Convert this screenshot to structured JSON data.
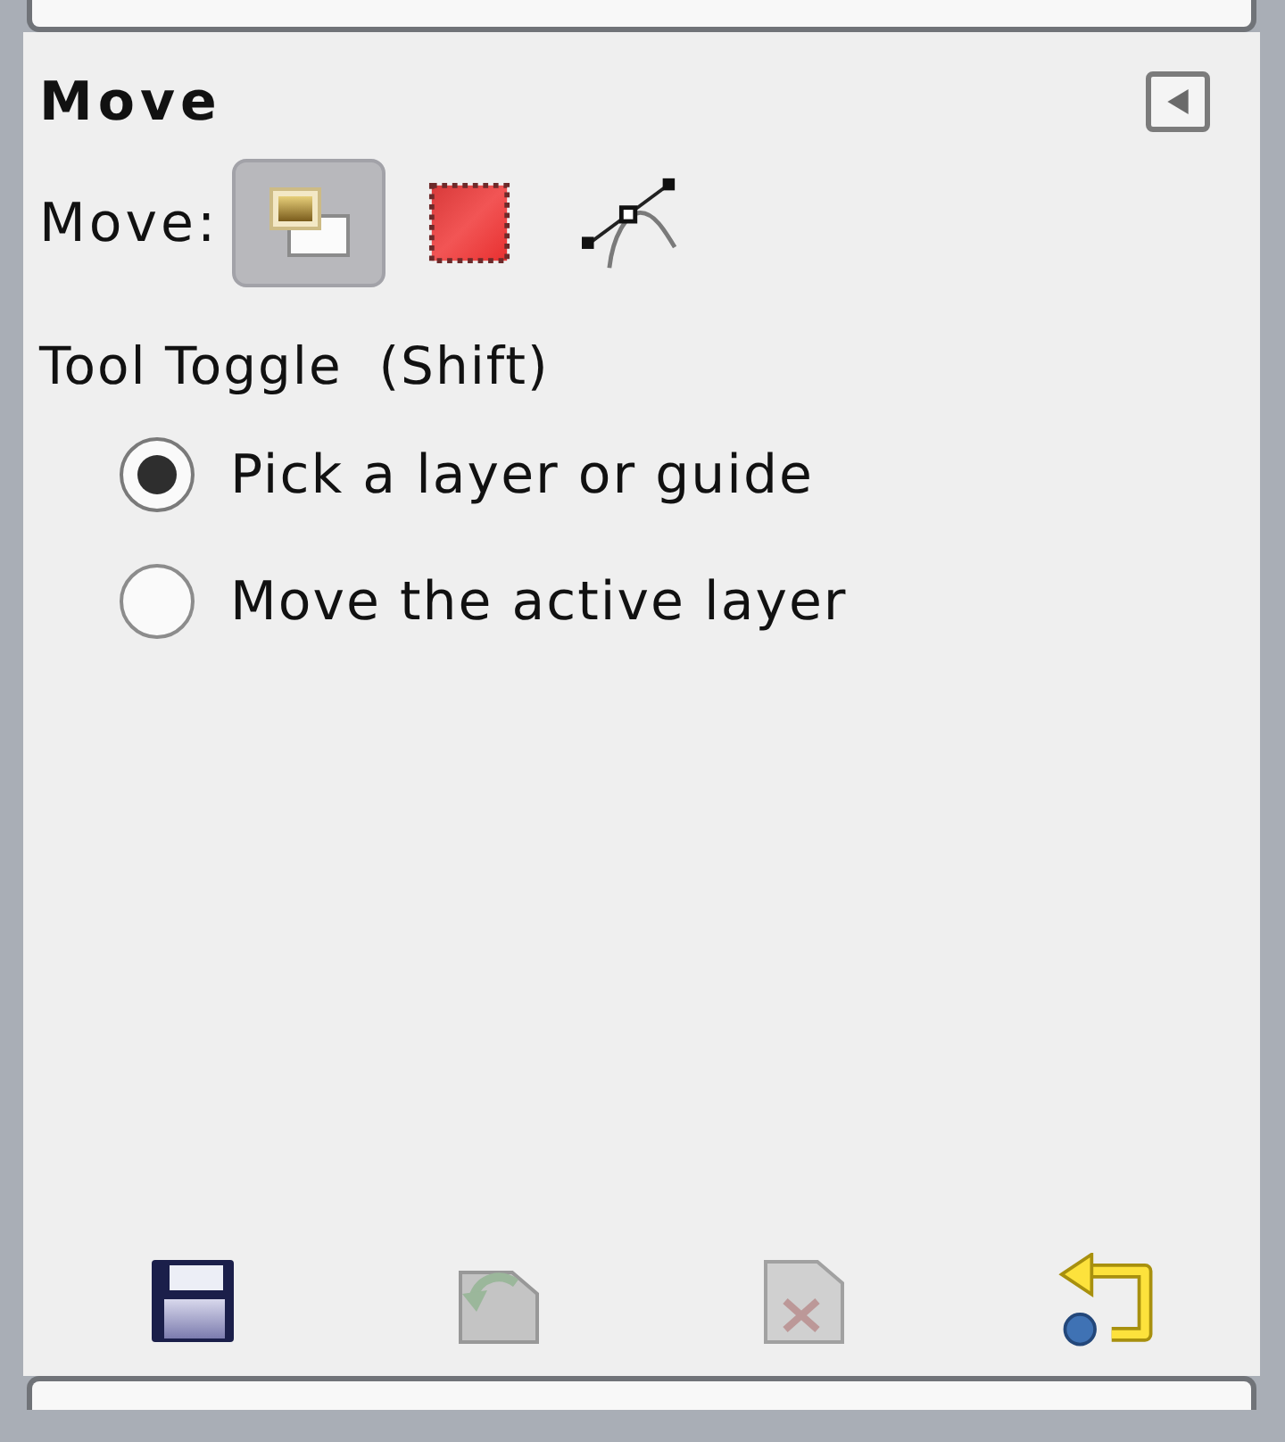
{
  "panel": {
    "title": "Move"
  },
  "move": {
    "label": "Move:",
    "modes": [
      {
        "kind": "layer",
        "selected": true
      },
      {
        "kind": "selection",
        "selected": false
      },
      {
        "kind": "path",
        "selected": false
      }
    ]
  },
  "tool_toggle": {
    "label": "Tool Toggle  (Shift)",
    "options": [
      {
        "label": "Pick a layer or guide",
        "selected": true
      },
      {
        "label": "Move the active layer",
        "selected": false
      }
    ]
  },
  "footer_buttons": [
    {
      "kind": "save",
      "disabled": false
    },
    {
      "kind": "restore",
      "disabled": true
    },
    {
      "kind": "delete",
      "disabled": true
    },
    {
      "kind": "reset",
      "disabled": false
    }
  ]
}
